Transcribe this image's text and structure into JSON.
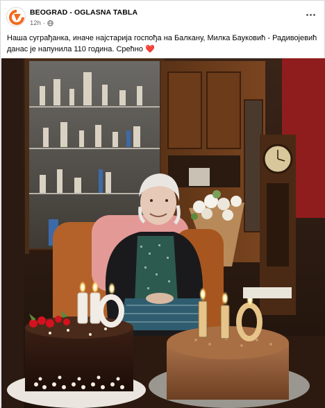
{
  "post": {
    "page_name": "BEOGRAD - OGLASNA TABLA",
    "time": "12h",
    "audience_icon": "globe-icon",
    "more_icon": "more-options-icon",
    "caption": "Наша суграђанка, иначе најстарија госпођа на Балкану, Милка Бауковић - Радивојевић данас је напунила 110 година. Срећно",
    "caption_emoji": "❤️"
  },
  "photo": {
    "description_candles_left": "110",
    "description_candles_right": "110"
  },
  "colors": {
    "brand_orange": "#f26a1b",
    "meta_gray": "#65676b"
  }
}
